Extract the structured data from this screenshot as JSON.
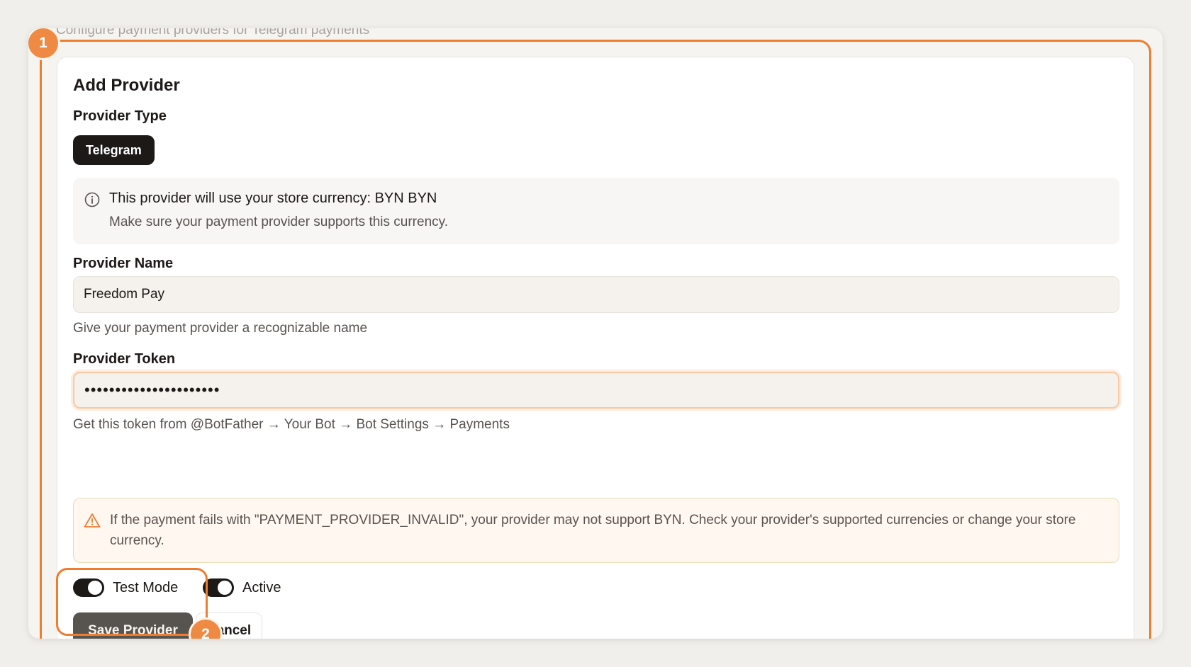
{
  "page": {
    "subtitle": "Configure payment providers for Telegram payments"
  },
  "form": {
    "title": "Add Provider",
    "provider_type_label": "Provider Type",
    "provider_type_selected": "Telegram",
    "info": {
      "line1": "This provider will use your store currency: BYN BYN",
      "line2": "Make sure your payment provider supports this currency.",
      "icon": "info-circle-icon"
    },
    "provider_name_label": "Provider Name",
    "provider_name_value": "Freedom Pay",
    "provider_name_help": "Give your payment provider a recognizable name",
    "provider_token_label": "Provider Token",
    "provider_token_value": "••••••••••••••••••••••",
    "provider_token_help": "Get this token from @BotFather → Your Bot → Bot Settings → Payments",
    "warning": {
      "text": "If the payment fails with \"PAYMENT_PROVIDER_INVALID\", your provider may not support BYN. Check your provider's supported currencies or change your store currency.",
      "icon": "warning-triangle-icon"
    },
    "test_mode": {
      "label": "Test Mode",
      "enabled": true
    },
    "active": {
      "label": "Active",
      "enabled": true
    },
    "save_label": "Save Provider",
    "cancel_label": "Cancel"
  },
  "annotations": {
    "badge_1": "1",
    "badge_2": "2",
    "accent_color": "#ef7c2f"
  }
}
